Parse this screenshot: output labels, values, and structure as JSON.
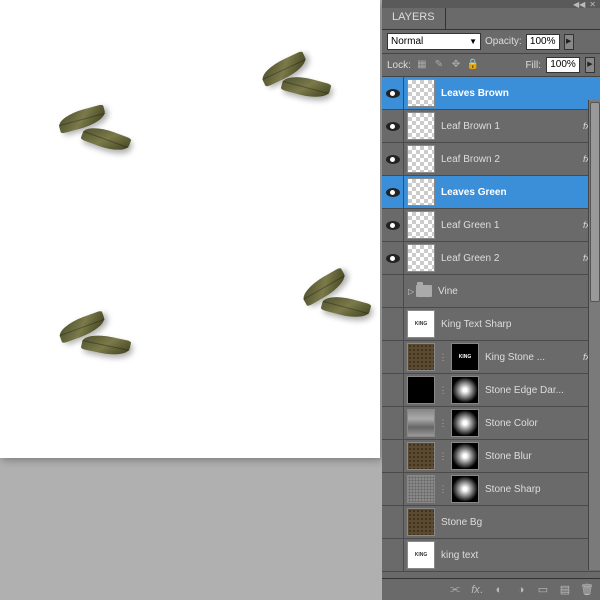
{
  "panel": {
    "title": "LAYERS"
  },
  "blend": {
    "mode": "Normal",
    "opacity_label": "Opacity:",
    "opacity": "100%",
    "fill_label": "Fill:",
    "fill": "100%",
    "lock_label": "Lock:"
  },
  "layers": [
    {
      "visible": true,
      "selected": true,
      "thumbs": [
        "checker"
      ],
      "name": "Leaves Brown",
      "fx": false
    },
    {
      "visible": true,
      "selected": false,
      "thumbs": [
        "checker"
      ],
      "name": "Leaf Brown 1",
      "fx": true
    },
    {
      "visible": true,
      "selected": false,
      "thumbs": [
        "checker"
      ],
      "name": "Leaf Brown 2",
      "fx": true
    },
    {
      "visible": true,
      "selected": true,
      "thumbs": [
        "checker"
      ],
      "name": "Leaves Green",
      "fx": false
    },
    {
      "visible": true,
      "selected": false,
      "thumbs": [
        "checker"
      ],
      "name": "Leaf Green 1",
      "fx": true
    },
    {
      "visible": true,
      "selected": false,
      "thumbs": [
        "checker"
      ],
      "name": "Leaf Green 2",
      "fx": true
    },
    {
      "visible": false,
      "selected": false,
      "thumbs": [],
      "name": "Vine",
      "fx": false,
      "group": true
    },
    {
      "visible": false,
      "selected": false,
      "thumbs": [
        "kingtxt"
      ],
      "name": "King Text Sharp",
      "fx": false
    },
    {
      "visible": false,
      "selected": false,
      "thumbs": [
        "texture",
        "link",
        "kingblk"
      ],
      "name": "King Stone ...",
      "fx": true
    },
    {
      "visible": false,
      "selected": false,
      "thumbs": [
        "black",
        "link",
        "radial"
      ],
      "name": "Stone Edge Dar...",
      "fx": false
    },
    {
      "visible": false,
      "selected": false,
      "thumbs": [
        "stonecolor",
        "link",
        "radial"
      ],
      "name": "Stone Color",
      "fx": false
    },
    {
      "visible": false,
      "selected": false,
      "thumbs": [
        "texture",
        "link",
        "radial"
      ],
      "name": "Stone Blur",
      "fx": false
    },
    {
      "visible": false,
      "selected": false,
      "thumbs": [
        "gray-tex",
        "link",
        "radial"
      ],
      "name": "Stone Sharp",
      "fx": false
    },
    {
      "visible": false,
      "selected": false,
      "thumbs": [
        "texture"
      ],
      "name": "Stone Bg",
      "fx": false
    },
    {
      "visible": false,
      "selected": false,
      "thumbs": [
        "kingtxt"
      ],
      "name": "king text",
      "fx": false
    }
  ],
  "king_label": "KING"
}
